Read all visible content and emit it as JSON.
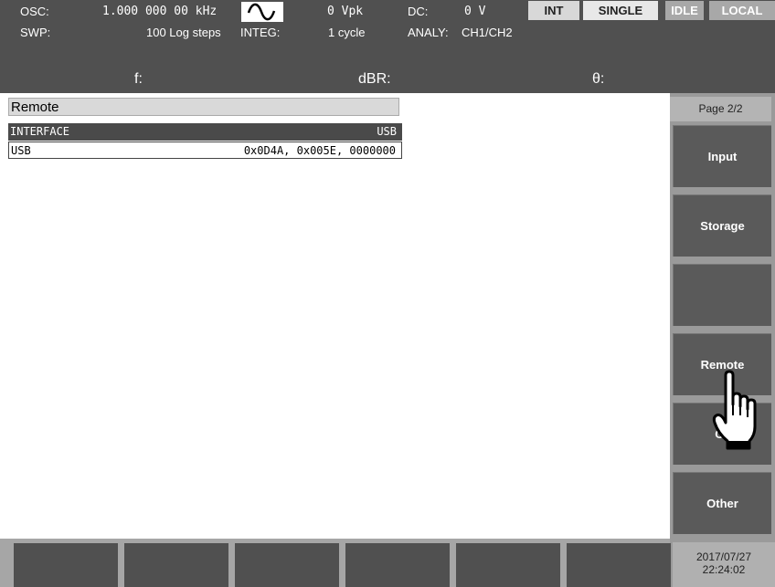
{
  "status": {
    "osc_label": "OSC:",
    "osc_value": "1.000 000 00 kHz",
    "amp_value": "0 Vpk",
    "dc_label": "DC:",
    "dc_value": "0 V",
    "swp_label": "SWP:",
    "swp_value": "100 Log steps",
    "integ_label": "INTEG:",
    "integ_value": "1 cycle",
    "analy_label": "ANALY:",
    "analy_value": "CH1/CH2",
    "int_label": "INT",
    "single_label": "SINGLE",
    "idle_label": "IDLE",
    "local_label": "LOCAL",
    "waveform_icon": "sine-wave-icon"
  },
  "measure": {
    "f_label": "f:",
    "dbr_label": "dBR:",
    "theta_label": "θ:"
  },
  "remote": {
    "title": "Remote",
    "rows": [
      {
        "label": "INTERFACE",
        "value": "USB"
      },
      {
        "label": "USB",
        "value": "0x0D4A, 0x005E, 0000000"
      }
    ]
  },
  "softkeys": {
    "page": "Page 2/2",
    "keys": [
      "Input",
      "Storage",
      "",
      "Remote",
      "Ca",
      "Other"
    ]
  },
  "bottom": {
    "date": "2017/07/27",
    "time": "22:24:02"
  },
  "colors": {
    "bar_bg": "#505050",
    "softkey_bg": "#5a5a5a",
    "panel_bg": "#9a9a9a"
  },
  "cursor_icon": "pointing-hand-cursor-icon"
}
